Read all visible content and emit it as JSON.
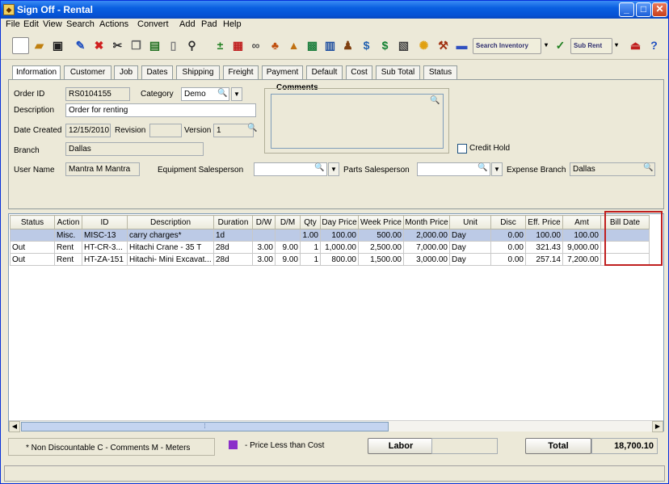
{
  "window": {
    "title": "Sign Off - Rental"
  },
  "menu": [
    "File",
    "Edit",
    "View",
    "Search",
    "Actions",
    "Convert",
    "Add",
    "Pad",
    "Help"
  ],
  "toolbar": {
    "search_inventory": "Search Inventory",
    "sub_rent": "Sub Rent"
  },
  "tabs": [
    "Information",
    "Customer",
    "Job",
    "Dates",
    "Shipping",
    "Freight",
    "Payment",
    "Default",
    "Cost",
    "Sub Total",
    "Status"
  ],
  "form": {
    "order_id_label": "Order ID",
    "order_id": "RS0104155",
    "category_label": "Category",
    "category": "Demo",
    "description_label": "Description",
    "description": "Order for renting",
    "date_created_label": "Date Created",
    "date_created": "12/15/2010",
    "revision_label": "Revision",
    "revision": "",
    "version_label": "Version",
    "version": "1",
    "branch_label": "Branch",
    "branch": "Dallas",
    "user_name_label": "User Name",
    "user_name": "Mantra M Mantra",
    "equip_sales_label": "Equipment Salesperson",
    "equip_sales": "",
    "parts_sales_label": "Parts Salesperson",
    "parts_sales": "",
    "expense_branch_label": "Expense Branch",
    "expense_branch": "Dallas",
    "comments_label": "Comments",
    "comments": "",
    "credit_hold_label": "Credit Hold"
  },
  "grid": {
    "columns": [
      "Status",
      "Action",
      "ID",
      "Description",
      "Duration",
      "D/W",
      "D/M",
      "Qty",
      "Day Price",
      "Week Price",
      "Month Price",
      "Unit",
      "Disc",
      "Eff. Price",
      "Amt",
      "Bill Date"
    ],
    "rows": [
      [
        "",
        "Misc.",
        "MISC-13",
        "carry charges*",
        "1d",
        "",
        "",
        "1.00",
        "100.00",
        "500.00",
        "2,000.00",
        "Day",
        "0.00",
        "100.00",
        "100.00",
        ""
      ],
      [
        "Out",
        "Rent",
        "HT-CR-3...",
        "Hitachi Crane - 35 T",
        "28d",
        "3.00",
        "9.00",
        "1",
        "1,000.00",
        "2,500.00",
        "7,000.00",
        "Day",
        "0.00",
        "321.43",
        "9,000.00",
        ""
      ],
      [
        "Out",
        "Rent",
        "HT-ZA-151",
        "Hitachi- Mini Excavat...",
        "28d",
        "3.00",
        "9.00",
        "1",
        "800.00",
        "1,500.00",
        "3,000.00",
        "Day",
        "0.00",
        "257.14",
        "7,200.00",
        ""
      ]
    ]
  },
  "footer": {
    "legend": "* Non Discountable   C - Comments   M - Meters",
    "price_less": "- Price Less than Cost",
    "labor_label": "Labor",
    "labor_value": "",
    "total_label": "Total",
    "total_value": "18,700.10",
    "price_less_color": "#8b2fc9"
  }
}
